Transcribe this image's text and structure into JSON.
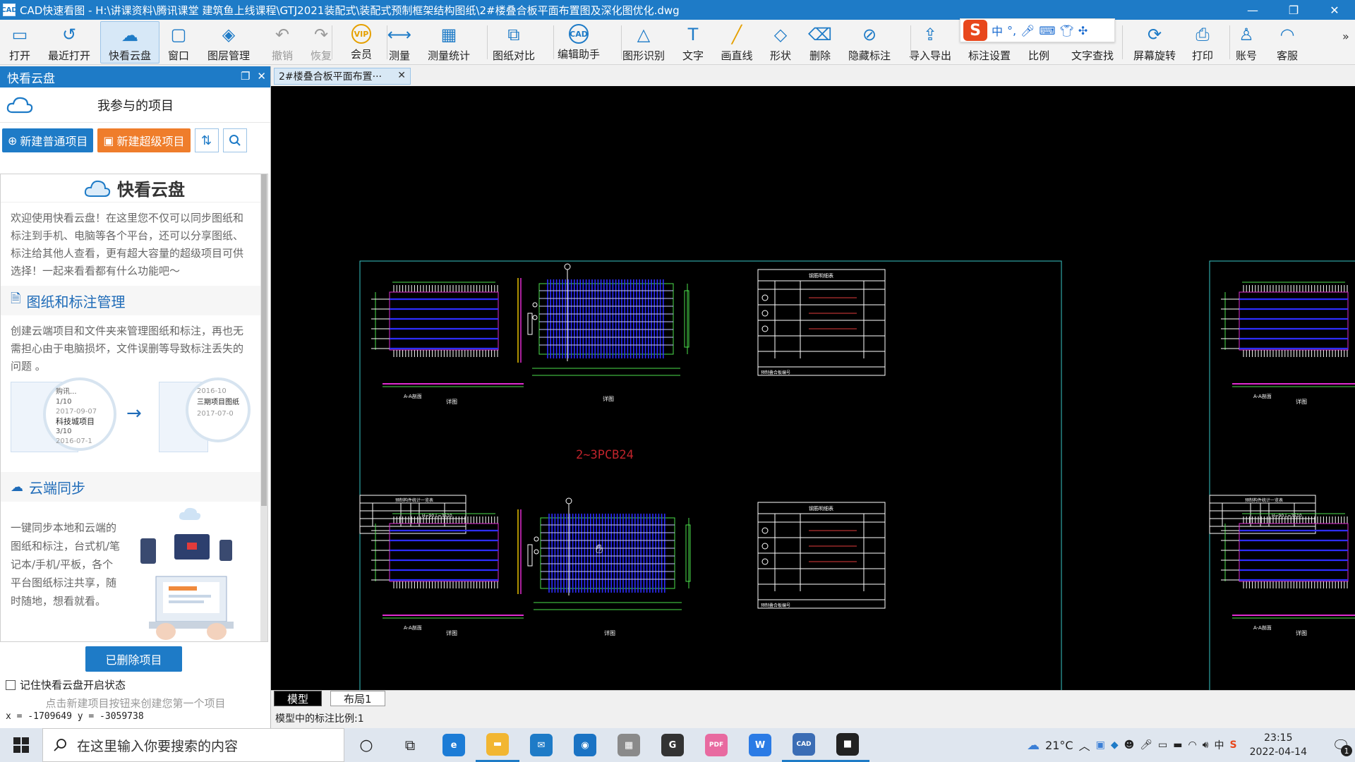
{
  "window": {
    "title": "CAD快速看图 - H:\\讲课资料\\腾讯课堂 建筑鱼上线课程\\GTJ2021装配式\\装配式预制框架结构图纸\\2#楼叠合板平面布置图及深化图优化.dwg",
    "app_icon_text": "CAD"
  },
  "toolbar": {
    "items": [
      {
        "id": "open",
        "label": "打开",
        "icon": "folder-icon"
      },
      {
        "id": "recent",
        "label": "最近打开",
        "icon": "history-icon"
      },
      {
        "id": "cloud",
        "label": "快看云盘",
        "icon": "cloud-icon",
        "active": true
      },
      {
        "id": "window",
        "label": "窗口",
        "icon": "window-icon"
      },
      {
        "id": "layers",
        "label": "图层管理",
        "icon": "layers-icon"
      },
      {
        "id": "undo",
        "label": "撤销",
        "icon": "undo-icon",
        "disabled": true
      },
      {
        "id": "redo",
        "label": "恢复",
        "icon": "redo-icon",
        "disabled": true
      },
      {
        "id": "vip",
        "label": "会员",
        "icon": "vip-icon"
      },
      {
        "id": "measure",
        "label": "测量",
        "icon": "ruler-icon"
      },
      {
        "id": "measure-stats",
        "label": "测量统计",
        "icon": "stats-icon"
      },
      {
        "id": "compare",
        "label": "图纸对比",
        "icon": "compare-icon"
      },
      {
        "id": "edit-helper",
        "label": "编辑助手",
        "icon": "cad-edit-icon"
      },
      {
        "id": "shape-recognize",
        "label": "图形识别",
        "icon": "shape-recognize-icon"
      },
      {
        "id": "text",
        "label": "文字",
        "icon": "text-icon"
      },
      {
        "id": "line",
        "label": "画直线",
        "icon": "line-icon"
      },
      {
        "id": "shape",
        "label": "形状",
        "icon": "shape-icon"
      },
      {
        "id": "delete",
        "label": "删除",
        "icon": "eraser-icon"
      },
      {
        "id": "hide-annot",
        "label": "隐藏标注",
        "icon": "eye-hide-icon"
      },
      {
        "id": "import-export",
        "label": "导入导出",
        "icon": "export-icon"
      },
      {
        "id": "annot-settings",
        "label": "标注设置",
        "icon": "settings-icon"
      },
      {
        "id": "scale",
        "label": "比例",
        "icon": "scale-icon"
      },
      {
        "id": "text-search",
        "label": "文字查找",
        "icon": "text-search-icon"
      },
      {
        "id": "rotate",
        "label": "屏幕旋转",
        "icon": "rotate-icon"
      },
      {
        "id": "print",
        "label": "打印",
        "icon": "printer-icon"
      },
      {
        "id": "account",
        "label": "账号",
        "icon": "user-icon"
      },
      {
        "id": "service",
        "label": "客服",
        "icon": "headset-icon"
      }
    ],
    "more": "»"
  },
  "ime": {
    "mode": "中",
    "punct": "°,"
  },
  "left_panel": {
    "header": "快看云盘",
    "project_title": "我参与的项目",
    "btn_new_normal": "新建普通项目",
    "btn_new_super": "新建超级项目",
    "cloud_title": "快看云盘",
    "intro": "欢迎使用快看云盘！在这里您不仅可以同步图纸和标注到手机、电脑等各个平台，还可以分享图纸、标注给其他人查看，更有超大容量的超级项目可供选择！一起来看看都有什么功能吧～",
    "section1_title": "图纸和标注管理",
    "section1_text": "创建云端项目和文件夹来管理图纸和标注，再也无需担心由于电脑损坏，文件误删等导致标注丢失的问题 。",
    "illus1": {
      "left_lines": [
        "购讯...",
        "1/10",
        "2017-09-07",
        "科技城项目",
        "3/10",
        "2016-07-1"
      ],
      "right_lines": [
        "2016-10",
        "三期项目图纸",
        "2017-07-0"
      ]
    },
    "section2_title": "云端同步",
    "section2_text": "一键同步本地和云端的图纸和标注，台式机/笔记本/手机/平板，各个平台图纸标注共享，随时随地，想看就看。",
    "btn_deleted": "已删除项目",
    "remember": "记住快看云盘开启状态",
    "hint": "点击新建项目按钮来创建您第一个项目"
  },
  "doc_tab": {
    "label": "2#楼叠合板平面布置···",
    "close": "✕"
  },
  "canvas": {
    "center_label": "2~3PCB24",
    "table_header": "钢筋明细表",
    "stat_table_title": "预制构件统计一览表",
    "stat_row": "H=90  L=3510",
    "detail_title": "详图",
    "section_title": "A-A剖面",
    "note_text": "预制叠合板编号"
  },
  "layout_tabs": {
    "model": "模型",
    "layout1": "布局1"
  },
  "status": {
    "coords": "x = -1709649 y = -3059738",
    "model_scale": "模型中的标注比例:1"
  },
  "taskbar": {
    "search_placeholder": "在这里输入你要搜索的内容",
    "weather": "21°C",
    "time": "23:15",
    "date": "2022-04-14",
    "notify_count": "1",
    "ime_mode": "中",
    "apps": [
      {
        "name": "edge-icon",
        "color": "#1c7cd6",
        "text": "e"
      },
      {
        "name": "explorer-icon",
        "color": "#f2b632",
        "text": "▬"
      },
      {
        "name": "mail-icon",
        "color": "#1e7bc7",
        "text": "✉"
      },
      {
        "name": "video-app-icon",
        "color": "#1a73c4",
        "text": "◉"
      },
      {
        "name": "calculator-icon",
        "color": "#8a8a8a",
        "text": "▦"
      },
      {
        "name": "glodon-icon",
        "color": "#333333",
        "text": "G"
      },
      {
        "name": "wps-pdf-icon",
        "color": "#e86aa0",
        "text": "PDF"
      },
      {
        "name": "wps-writer-icon",
        "color": "#2b7be5",
        "text": "W"
      },
      {
        "name": "cad-viewer-icon",
        "color": "#3b6db5",
        "text": "CAD"
      },
      {
        "name": "camera-app-icon",
        "color": "#222222",
        "text": "■"
      }
    ]
  }
}
